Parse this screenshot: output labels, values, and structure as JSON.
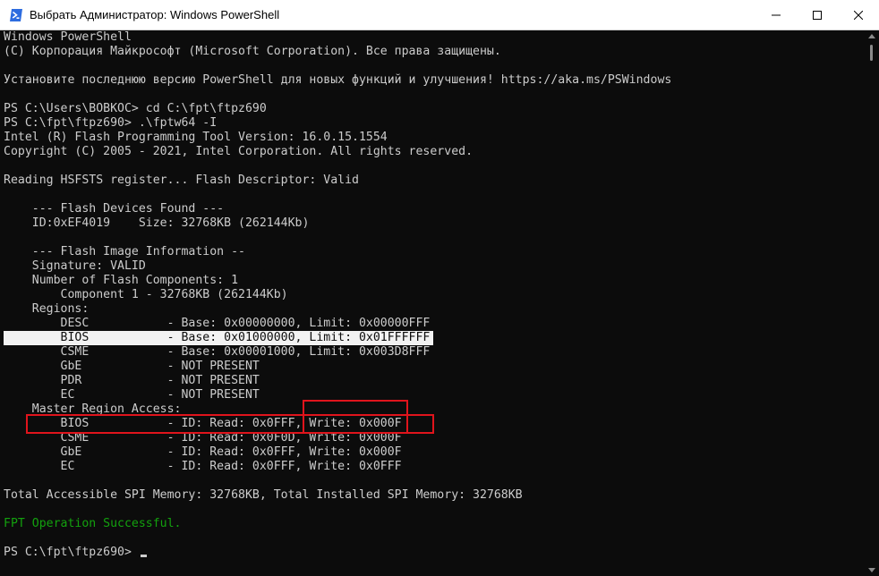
{
  "window": {
    "title": "Выбрать Администратор: Windows PowerShell",
    "app_icon": "powershell-icon",
    "controls": [
      "minimize-icon",
      "maximize-icon",
      "close-icon"
    ]
  },
  "console": {
    "lines": [
      "Windows PowerShell",
      "(C) Корпорация Майкрософт (Microsoft Corporation). Все права защищены.",
      "",
      "Установите последнюю версию PowerShell для новых функций и улучшения! https://aka.ms/PSWindows",
      "",
      "PS C:\\Users\\BOBKOC> cd C:\\fpt\\ftpz690",
      "PS C:\\fpt\\ftpz690> .\\fptw64 -I",
      "Intel (R) Flash Programming Tool Version: 16.0.15.1554",
      "Copyright (C) 2005 - 2021, Intel Corporation. All rights reserved.",
      "",
      "Reading HSFSTS register... Flash Descriptor: Valid",
      "",
      "    --- Flash Devices Found ---",
      "    ID:0xEF4019    Size: 32768KB (262144Kb)",
      "",
      "    --- Flash Image Information --",
      "    Signature: VALID",
      "    Number of Flash Components: 1",
      "        Component 1 - 32768KB (262144Kb)",
      "    Regions:",
      "        DESC           - Base: 0x00000000, Limit: 0x00000FFF",
      "        BIOS           - Base: 0x01000000, Limit: 0x01FFFFFF",
      "        CSME           - Base: 0x00001000, Limit: 0x003D8FFF",
      "        GbE            - NOT PRESENT",
      "        PDR            - NOT PRESENT",
      "        EC             - NOT PRESENT",
      "    Master Region Access:",
      "        BIOS           - ID: Read: 0x0FFF, Write: 0x000F",
      "        CSME           - ID: Read: 0x0F0D, Write: 0x000F",
      "        GbE            - ID: Read: 0x0FFF, Write: 0x000F",
      "        EC             - ID: Read: 0x0FFF, Write: 0x0FFF",
      "",
      "Total Accessible SPI Memory: 32768KB, Total Installed SPI Memory: 32768KB",
      "",
      "FPT Operation Successful.",
      "",
      "PS C:\\fpt\\ftpz690> "
    ],
    "text_color": "#cccccc",
    "success_color": "#13a10e",
    "background": "#0c0c0c",
    "highlight_color": "#e0141c"
  }
}
